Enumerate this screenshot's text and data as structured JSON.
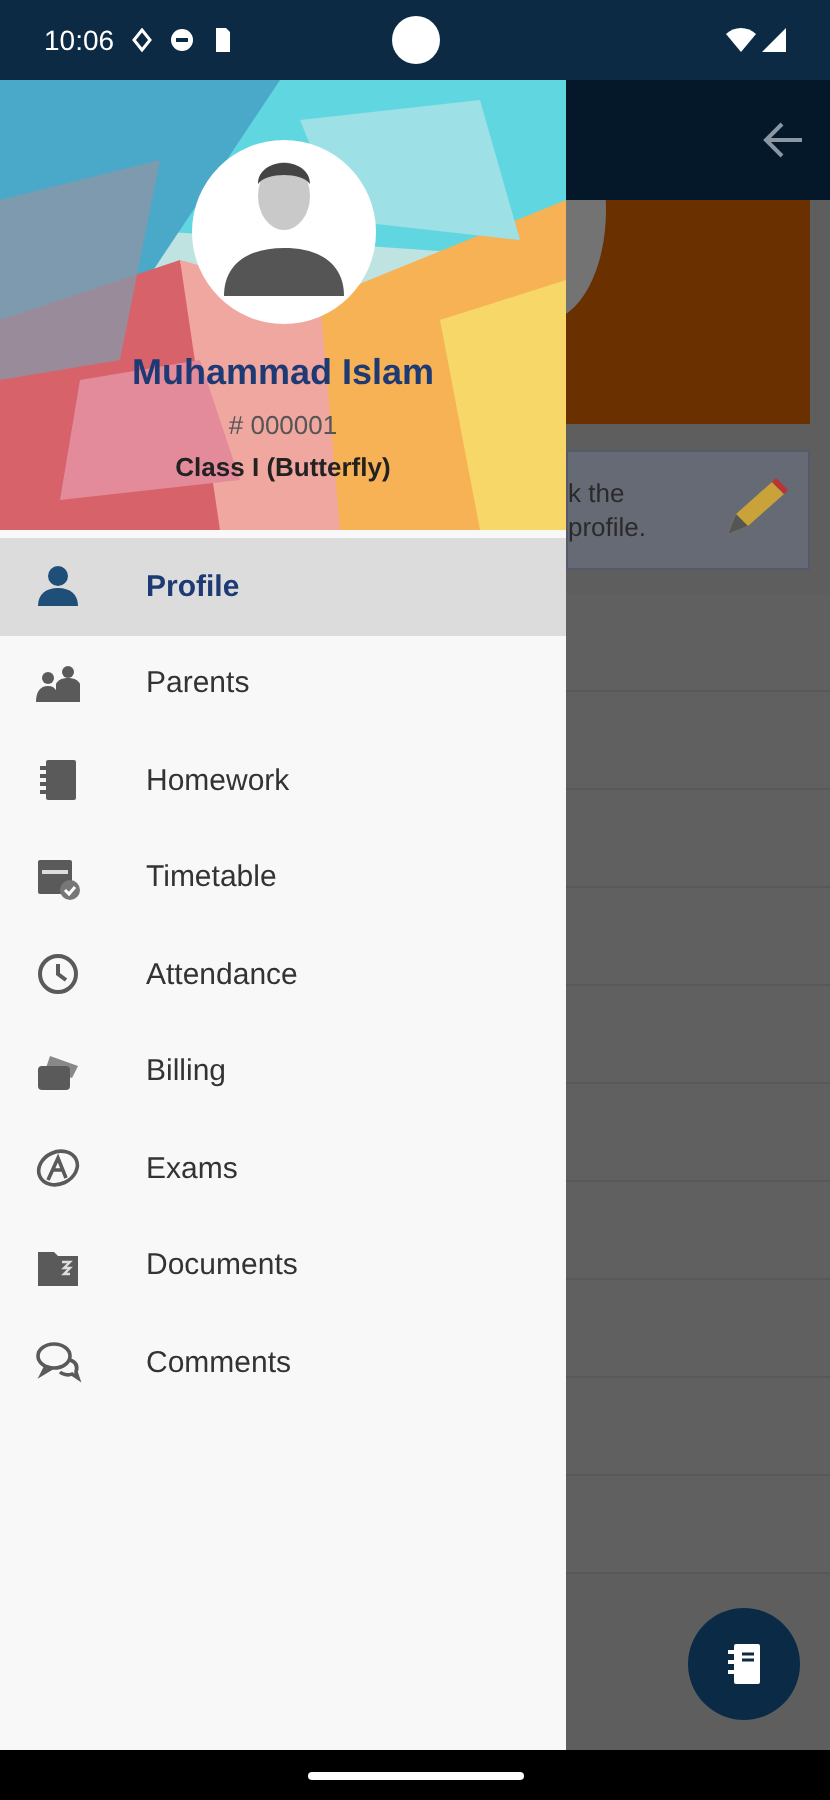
{
  "status_bar": {
    "time": "10:06"
  },
  "drawer": {
    "header": {
      "name": "Muhammad Islam",
      "number": "# 000001",
      "class_name": "Class I (Butterfly)"
    },
    "items": [
      {
        "label": "Profile",
        "kind": "profile",
        "selected": true
      },
      {
        "label": "Parents",
        "kind": "parents",
        "selected": false
      },
      {
        "label": "Homework",
        "kind": "homework",
        "selected": false
      },
      {
        "label": "Timetable",
        "kind": "timetable",
        "selected": false
      },
      {
        "label": "Attendance",
        "kind": "attendance",
        "selected": false
      },
      {
        "label": "Billing",
        "kind": "billing",
        "selected": false
      },
      {
        "label": "Exams",
        "kind": "exams",
        "selected": false
      },
      {
        "label": "Documents",
        "kind": "documents",
        "selected": false
      },
      {
        "label": "Comments",
        "kind": "comments",
        "selected": false
      }
    ]
  },
  "background_screen": {
    "card_lines": [
      "k the",
      "profile."
    ]
  }
}
